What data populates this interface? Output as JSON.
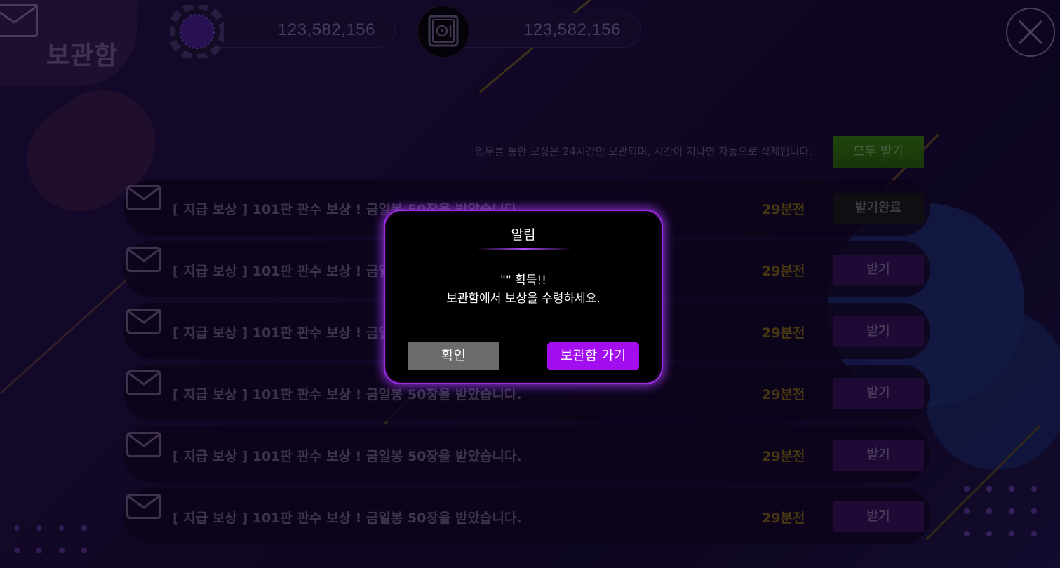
{
  "header": {
    "title": "보관함",
    "chips_value": "123,582,156",
    "safe_value": "123,582,156"
  },
  "notice": "업무를 통한 보상은 24시간만 보관되며, 시간이 지나면 자동으로 삭제됩니다.",
  "receive_all_label": "모두 받기",
  "messages": [
    {
      "text": "[ 지급 보상 ] 101판 판수 보상 ! 금일봉 50장을 받았습니다.",
      "time": "29분전",
      "action": "받기완료"
    },
    {
      "text": "[ 지급 보상 ] 101판 판수 보상 ! 금일봉 50장을 받았습니다.",
      "time": "29분전",
      "action": "받기"
    },
    {
      "text": "[ 지급 보상 ] 101판 판수 보상 ! 금일봉 50장을 받았습니다.",
      "time": "29분전",
      "action": "받기"
    },
    {
      "text": "[ 지급 보상 ] 101판 판수 보상 ! 금일봉 50장을 받았습니다.",
      "time": "29분전",
      "action": "받기"
    },
    {
      "text": "[ 지급 보상 ] 101판 판수 보상 ! 금일봉 50장을 받았습니다.",
      "time": "29분전",
      "action": "받기"
    },
    {
      "text": "[ 지급 보상 ] 101판 판수 보상 ! 금일봉 50장을 받았습니다.",
      "time": "29분전",
      "action": "받기"
    }
  ],
  "dialog": {
    "title": "알림",
    "line1": "\"\" 획득!!",
    "line2": "보관함에서 보상을 수령하세요.",
    "confirm_label": "확인",
    "goto_label": "보관함 가기"
  },
  "icons": {
    "title": "mail-icon",
    "chips": "poker-chip-icon",
    "safe": "safe-icon",
    "close": "close-icon",
    "row": "envelope-icon"
  },
  "colors": {
    "accent": "#a20ef0",
    "receive_all": "#2f6a0e",
    "time": "#6b5416"
  }
}
